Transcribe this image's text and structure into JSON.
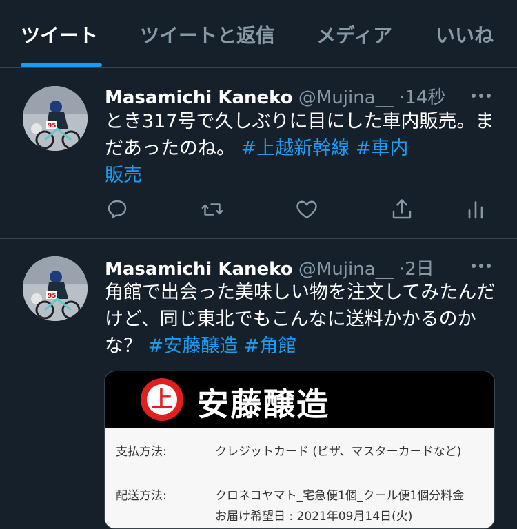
{
  "tabs": [
    {
      "label": "ツイート"
    },
    {
      "label": "ツイートと返信"
    },
    {
      "label": "メディア"
    },
    {
      "label": "いいね"
    }
  ],
  "tweets": [
    {
      "name": "Masamichi Kaneko",
      "handle": "@Mujina__",
      "dot": "·",
      "time": "14秒",
      "text_plain": "とき317号で久しぶりに目にした車内販売。まだあったのね。",
      "hashtag_1": "#上越新幹線",
      "hashtag_2a": "#車内",
      "hashtag_2b": "販売"
    },
    {
      "name": "Masamichi Kaneko",
      "handle": "@Mujina__",
      "dot": "·",
      "time": "2日",
      "text_plain": "角館で出会った美味しい物を注文してみたんだけど、同じ東北でもこんなに送料かかるのかな？",
      "hashtag_1": "#安藤醸造",
      "hashtag_2": "#角館",
      "card": {
        "logo_char": "上",
        "brand": "安藤醸造",
        "rows": [
          {
            "label": "支払方法:",
            "value": "クレジットカード (ビザ、マスターカードなど)"
          },
          {
            "label": "配送方法:",
            "value": "クロネコヤマト_宅急便1個_クール便1個分料金",
            "value2": "お届け希望日 : 2021年09月14日(火)"
          }
        ]
      }
    }
  ],
  "icons": {
    "reply": "reply-icon",
    "retweet": "retweet-icon",
    "like": "heart-icon",
    "share": "share-icon",
    "analytics": "analytics-icon",
    "more": "more-icon"
  },
  "colors": {
    "background": "#15202b",
    "accent": "#1d9bf0",
    "muted": "#8899a6",
    "border": "#38444d"
  }
}
